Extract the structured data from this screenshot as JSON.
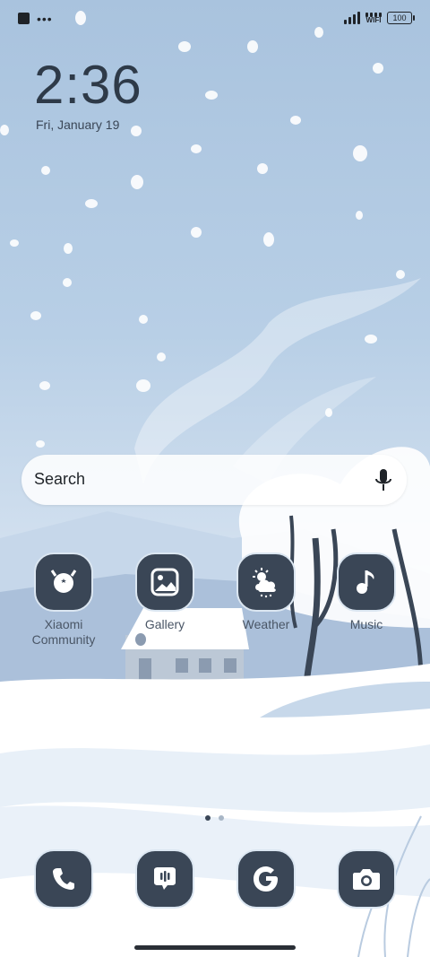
{
  "status_bar": {
    "battery": "100",
    "wifi_label": "WIFI"
  },
  "lock": {
    "time": "2:36",
    "date": "Fri, January 19"
  },
  "search": {
    "placeholder": "Search"
  },
  "apps": [
    {
      "label": "Xiaomi Community",
      "icon": "robot-icon"
    },
    {
      "label": "Gallery",
      "icon": "image-icon"
    },
    {
      "label": "Weather",
      "icon": "weather-sun-cloud-icon"
    },
    {
      "label": "Music",
      "icon": "music-note-icon"
    }
  ],
  "dock": [
    {
      "name": "phone",
      "icon": "phone-icon"
    },
    {
      "name": "messages",
      "icon": "message-icon"
    },
    {
      "name": "google",
      "icon": "google-icon"
    },
    {
      "name": "camera",
      "icon": "camera-icon"
    }
  ],
  "pager": {
    "pages": 2,
    "active": 1
  },
  "colors": {
    "icon_bg": "#3a4656",
    "sky_top": "#a9c3de",
    "snow": "#ffffff"
  }
}
